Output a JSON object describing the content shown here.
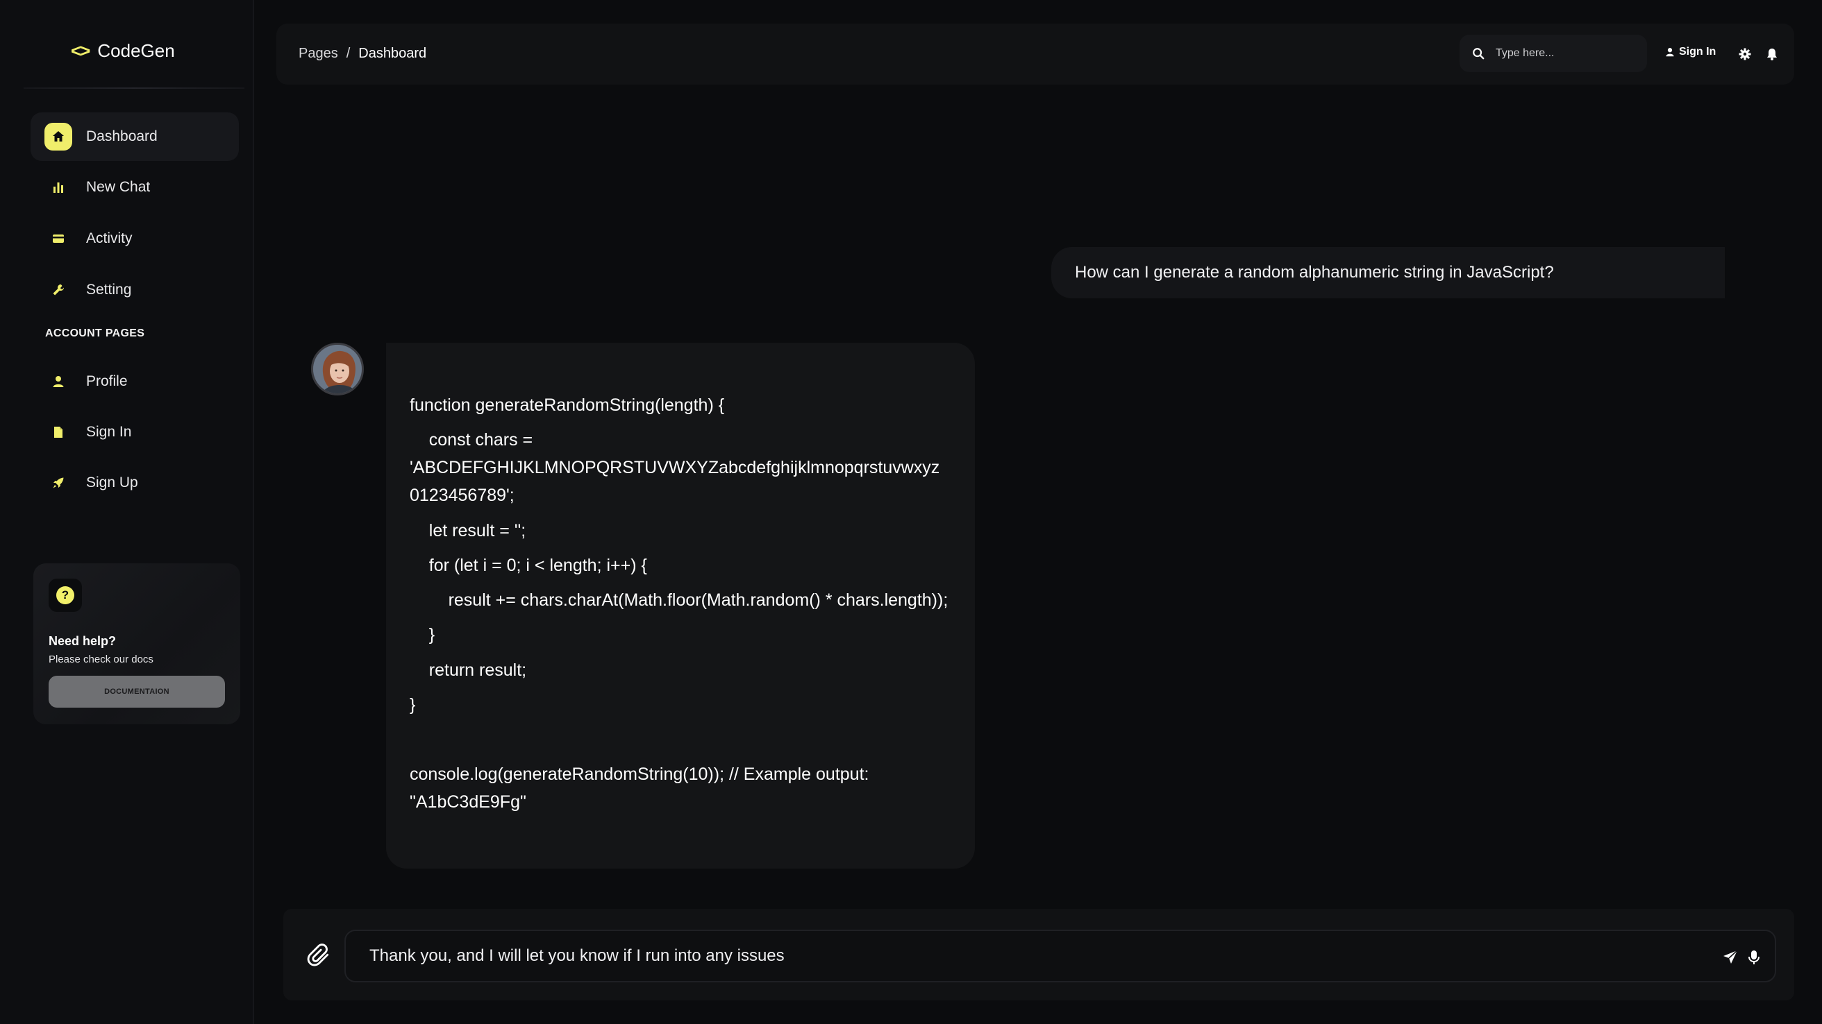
{
  "brand": {
    "logo_glyph": "<>",
    "name": "CodeGen"
  },
  "sidebar": {
    "items": [
      {
        "label": "Dashboard",
        "icon": "home-icon",
        "active": true
      },
      {
        "label": "New Chat",
        "icon": "bar-chart-icon"
      },
      {
        "label": "Activity",
        "icon": "credit-card-icon"
      },
      {
        "label": "Setting",
        "icon": "wrench-icon"
      }
    ],
    "section_label": "ACCOUNT PAGES",
    "account_items": [
      {
        "label": "Profile",
        "icon": "person-icon"
      },
      {
        "label": "Sign In",
        "icon": "document-icon"
      },
      {
        "label": "Sign Up",
        "icon": "rocket-icon"
      }
    ],
    "help": {
      "icon": "?",
      "title": "Need help?",
      "subtitle": "Please check our docs",
      "button_label": "DOCUMENTAION"
    }
  },
  "topbar": {
    "breadcrumb_root": "Pages",
    "breadcrumb_sep": "/",
    "breadcrumb_current": "Dashboard",
    "search_placeholder": "Type here...",
    "sign_in_label": "Sign In"
  },
  "chat": {
    "user_message": "How can I generate a random alphanumeric string in JavaScript?",
    "code_lines": [
      "function generateRandomString(length) {",
      "    const chars =",
      "'ABCDEFGHIJKLMNOPQRSTUVWXYZabcdefghijklmnopqrstuvwxyz",
      "0123456789';",
      "    let result = '';",
      "    for (let i = 0; i < length; i++) {",
      "        result += chars.charAt(Math.floor(Math.random() * chars.length));",
      "    }",
      "    return result;",
      "}",
      "console.log(generateRandomString(10)); // Example output:",
      "\"A1bC3dE9Fg\""
    ]
  },
  "composer": {
    "value": "Thank you, and I will let you know if I run into any issues"
  },
  "colors": {
    "accent": "#f0ee6b",
    "background": "#0b0c0e",
    "panel": "#111214"
  }
}
